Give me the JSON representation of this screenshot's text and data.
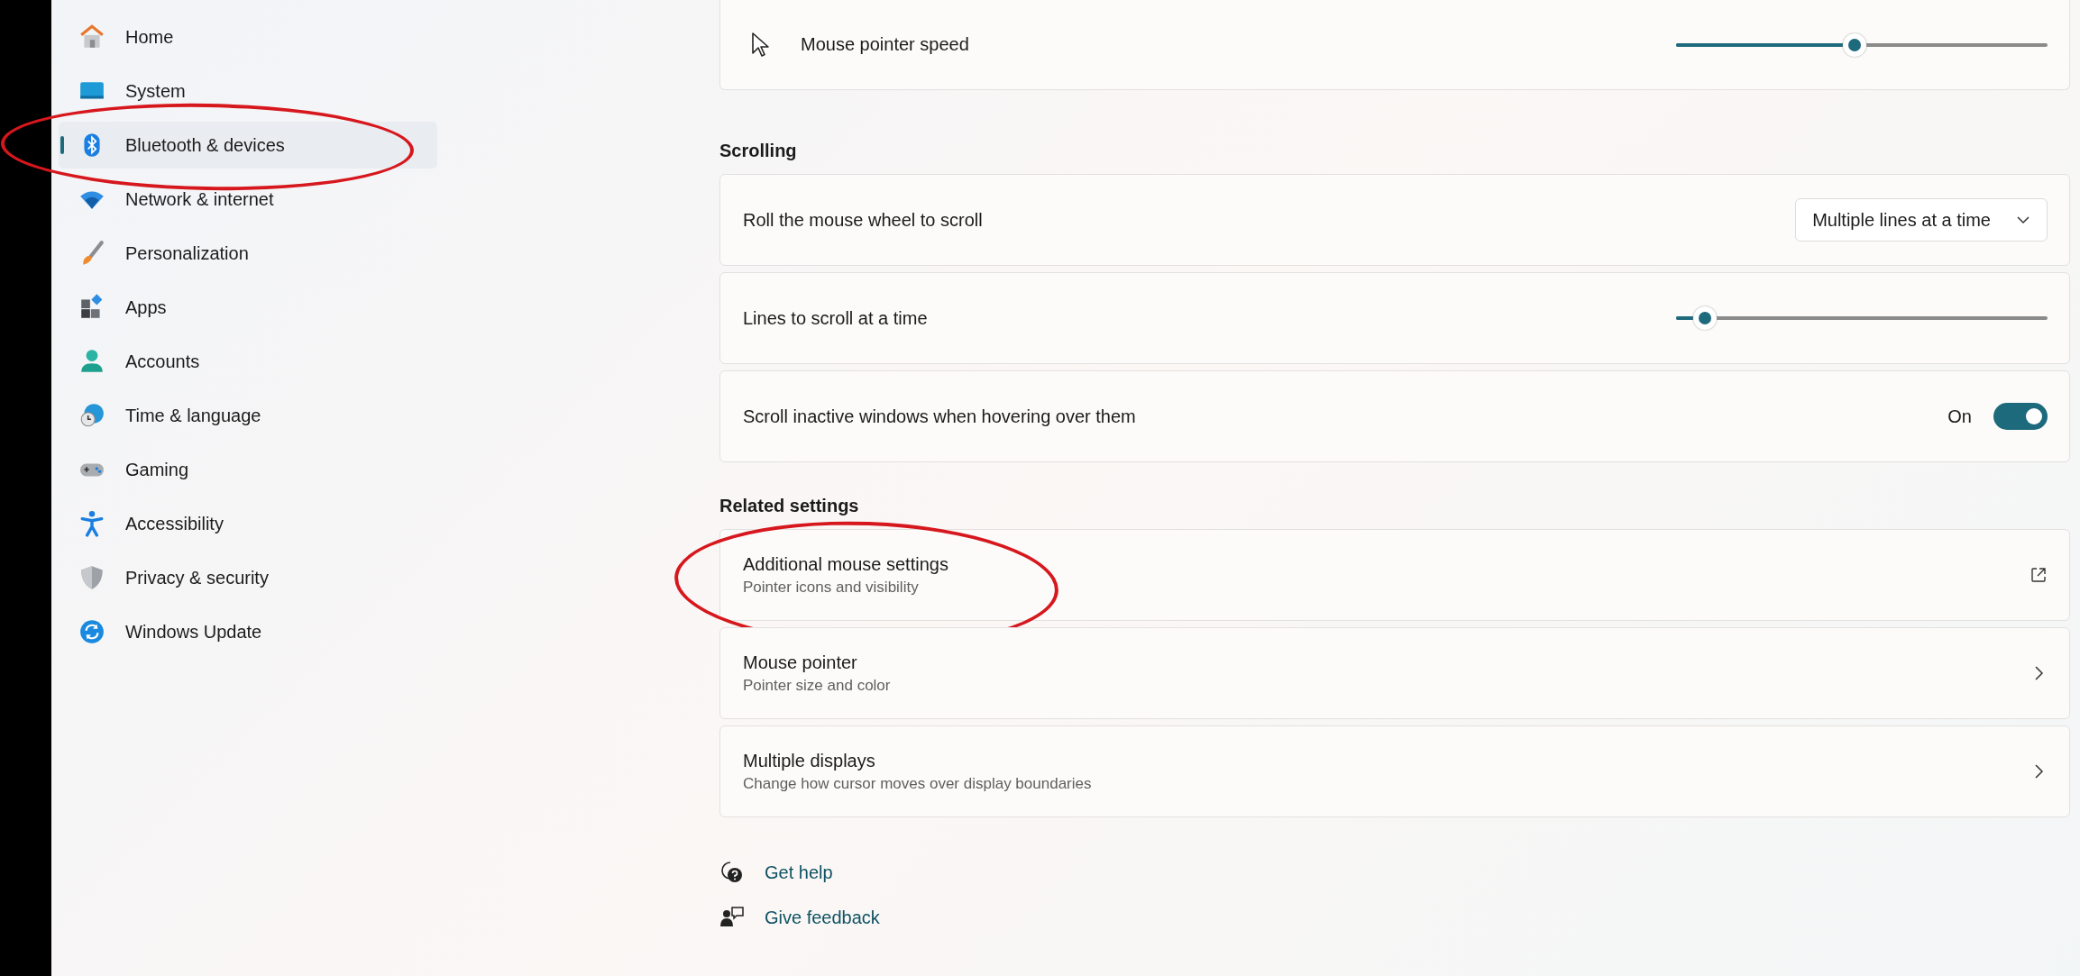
{
  "sidebar": {
    "items": [
      {
        "label": "Home",
        "selected": false,
        "circled": false
      },
      {
        "label": "System",
        "selected": false,
        "circled": false
      },
      {
        "label": "Bluetooth & devices",
        "selected": true,
        "circled": true
      },
      {
        "label": "Network & internet",
        "selected": false,
        "circled": false
      },
      {
        "label": "Personalization",
        "selected": false,
        "circled": false
      },
      {
        "label": "Apps",
        "selected": false,
        "circled": false
      },
      {
        "label": "Accounts",
        "selected": false,
        "circled": false
      },
      {
        "label": "Time & language",
        "selected": false,
        "circled": false
      },
      {
        "label": "Gaming",
        "selected": false,
        "circled": false
      },
      {
        "label": "Accessibility",
        "selected": false,
        "circled": false
      },
      {
        "label": "Privacy & security",
        "selected": false,
        "circled": false
      },
      {
        "label": "Windows Update",
        "selected": false,
        "circled": false
      }
    ]
  },
  "pointer": {
    "label": "Mouse pointer speed",
    "level": 0.48
  },
  "scrolling": {
    "heading": "Scrolling",
    "rows": [
      {
        "kind": "dropdown",
        "label": "Roll the mouse wheel to scroll",
        "value": "Multiple lines at a time"
      },
      {
        "kind": "slider",
        "label": "Lines to scroll at a time",
        "level": 0.05
      },
      {
        "kind": "toggle",
        "label": "Scroll inactive windows when hovering over them",
        "state_label": "On",
        "on": true
      }
    ]
  },
  "related": {
    "heading": "Related settings",
    "rows": [
      {
        "kind": "external",
        "title": "Additional mouse settings",
        "subtitle": "Pointer icons and visibility",
        "circled": true
      },
      {
        "kind": "navigate",
        "title": "Mouse pointer",
        "subtitle": "Pointer size and color",
        "circled": false
      },
      {
        "kind": "navigate",
        "title": "Multiple displays",
        "subtitle": "Change how cursor moves over display boundaries",
        "circled": false
      }
    ]
  },
  "help_links": [
    "Get help",
    "Give feedback"
  ]
}
